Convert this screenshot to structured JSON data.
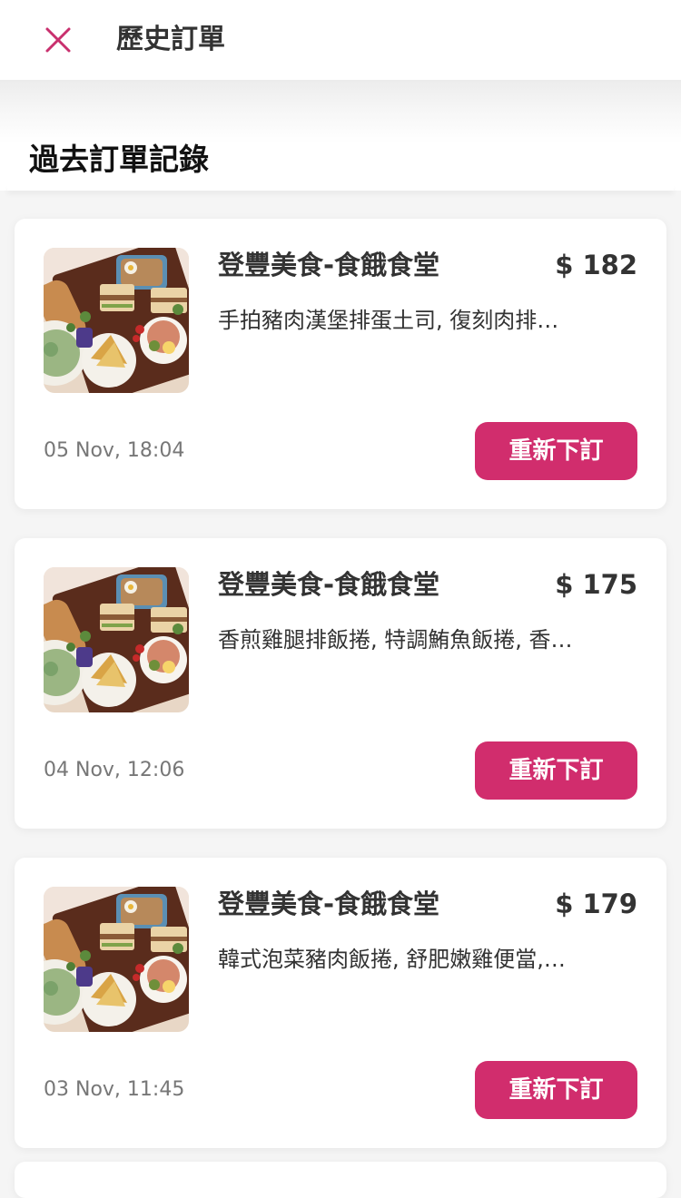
{
  "header": {
    "title": "歷史訂單",
    "close_icon": "close-icon"
  },
  "section": {
    "title": "過去訂單記錄"
  },
  "orders": [
    {
      "shop": "登豐美食-食餓食堂",
      "price": "$ 182",
      "items": "手拍豬肉漢堡排蛋土司, 復刻肉排…",
      "time": "05 Nov, 18:04",
      "reorder": "重新下訂"
    },
    {
      "shop": "登豐美食-食餓食堂",
      "price": "$ 175",
      "items": "香煎雞腿排飯捲, 特調鮪魚飯捲, 香…",
      "time": "04 Nov, 12:06",
      "reorder": "重新下訂"
    },
    {
      "shop": "登豐美食-食餓食堂",
      "price": "$ 179",
      "items": "韓式泡菜豬肉飯捲, 舒肥嫩雞便當,…",
      "time": "03 Nov, 11:45",
      "reorder": "重新下訂"
    }
  ],
  "colors": {
    "accent": "#d12d6d",
    "close_icon": "#c9306e",
    "background": "#f5f5f5",
    "card": "#ffffff"
  }
}
